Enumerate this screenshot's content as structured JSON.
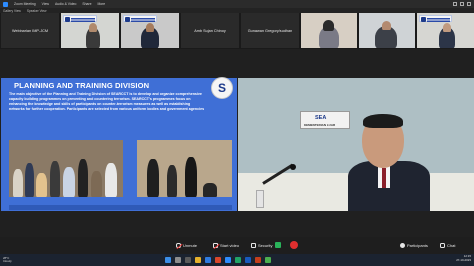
{
  "app": {
    "menu": [
      "Zoom Meeting",
      "View",
      "Audio & Video",
      "Share",
      "More"
    ],
    "sub": [
      "Gallery View",
      "Speaker View"
    ]
  },
  "participants": [
    {
      "name": "Webinarian IMP-JCM",
      "type": "plain"
    },
    {
      "name": "",
      "type": "video"
    },
    {
      "name": "",
      "type": "video"
    },
    {
      "name": "Amb Sujan Chinoy",
      "type": "plain"
    },
    {
      "name": "Gunawan Gregory/sudhan",
      "type": "plain"
    },
    {
      "name": "",
      "type": "video"
    },
    {
      "name": "",
      "type": "video"
    },
    {
      "name": "",
      "type": "video"
    }
  ],
  "slide": {
    "title": "PLANNING AND TRAINING DIVISION",
    "body": "The main objective of the Planning and Training Division of SEARCCT is to develop and organize comprehensive capacity building programmes on preventing and countering terrorism. SEARCCT's programmes focus on enhancing the knowledge and skills of participants on counter-terrorism measures as well as establishing networks for further cooperation. Participants are selected from various uniform bodies and government agencies",
    "logo_letter": "S"
  },
  "speaker": {
    "sign_title": "SEA",
    "sign_sub": "KEMENTERIAN LUAR"
  },
  "controls": {
    "unmute": "Unmute",
    "start_video": "Start video",
    "security": "Security",
    "participants": "Participants",
    "chat": "Chat"
  },
  "taskbar": {
    "weather_temp": "28°C",
    "weather_desc": "Cloudy",
    "time": "12:15",
    "date": "27-10-2023"
  },
  "colors": {
    "slide_bg": "#3f6fd6",
    "share": "#2ab35a",
    "leave": "#e02f2f"
  }
}
